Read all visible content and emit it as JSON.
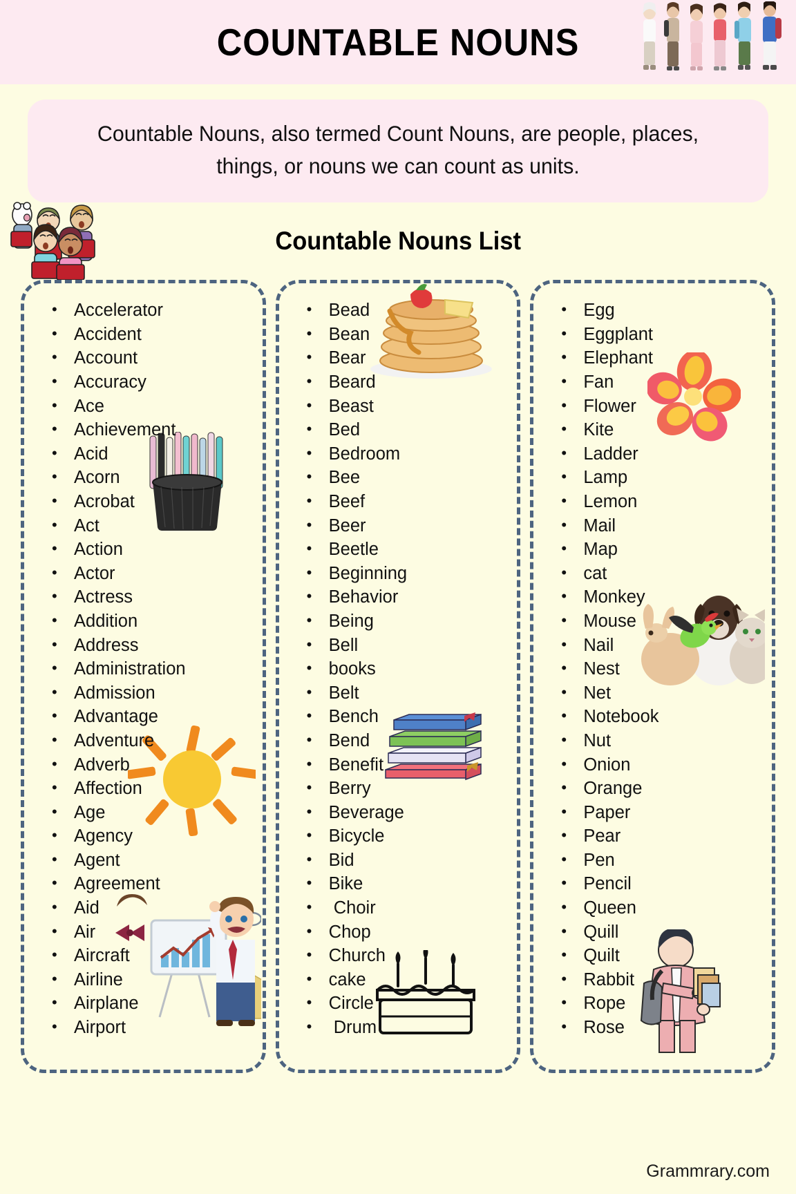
{
  "header": {
    "title": "COUNTABLE NOUNS",
    "people_image": "group-of-people-with-backpacks"
  },
  "definition": {
    "text": "Countable Nouns, also termed Count Nouns, are people, places, things, or nouns we can count as units."
  },
  "list_heading": {
    "text": "Countable Nouns List",
    "kids_image": "children-singing-with-books"
  },
  "columns": [
    {
      "name": "column-a",
      "items": [
        "Accelerator",
        "Accident",
        "Account",
        "Accuracy",
        "Ace",
        "Achievement",
        "Acid",
        "Acorn",
        "Acrobat",
        "Act",
        "Action",
        "Actor",
        "Actress",
        "Addition",
        "Address",
        "Administration",
        "Admission",
        "Advantage",
        "Adventure",
        "Adverb",
        "Affection",
        "Age",
        "Agency",
        "Agent",
        "Agreement",
        "Aid",
        "Air",
        "Aircraft",
        "Airline",
        "Airplane",
        "Airport"
      ],
      "art": [
        "pens-in-holder",
        "sun",
        "businessman-with-chart"
      ]
    },
    {
      "name": "column-b",
      "items": [
        "Bead",
        "Bean",
        "Bear",
        "Beard",
        "Beast",
        "Bed",
        "Bedroom",
        "Bee",
        "Beef",
        "Beer",
        "Beetle",
        "Beginning",
        "Behavior",
        "Being",
        "Bell",
        "books",
        "Belt",
        "Bench",
        "Bend",
        "Benefit",
        "Berry",
        "Beverage",
        "Bicycle",
        "Bid",
        "Bike",
        " Choir",
        "Chop",
        "Church",
        "cake",
        "Circle",
        " Drum"
      ],
      "art": [
        "pancake-stack",
        "stack-of-books",
        "birthday-cake"
      ]
    },
    {
      "name": "column-c",
      "items": [
        "Egg",
        "Eggplant",
        "Elephant",
        "Fan",
        "Flower",
        "Kite",
        "Ladder",
        "Lamp",
        "Lemon",
        "Mail",
        "Map",
        "cat",
        "Monkey",
        "Mouse",
        "Nail",
        "Nest",
        "Net",
        "Notebook",
        "Nut",
        "Onion",
        "Orange",
        "Paper",
        "Pear",
        "Pen",
        "Pencil",
        "Queen",
        "Quill",
        "Quilt",
        "Rabbit",
        "Rope",
        "Rose"
      ],
      "art": [
        "flower",
        "pets-dog-cat-rabbit-bird",
        "student-with-backpack"
      ]
    }
  ],
  "footer": {
    "site": "Grammrary.com"
  },
  "colors": {
    "page_background": "#fdfce2",
    "header_background": "#fdeaf1",
    "definition_background": "#fdeaf1",
    "dashed_border": "#4d6480",
    "text": "#111111"
  }
}
